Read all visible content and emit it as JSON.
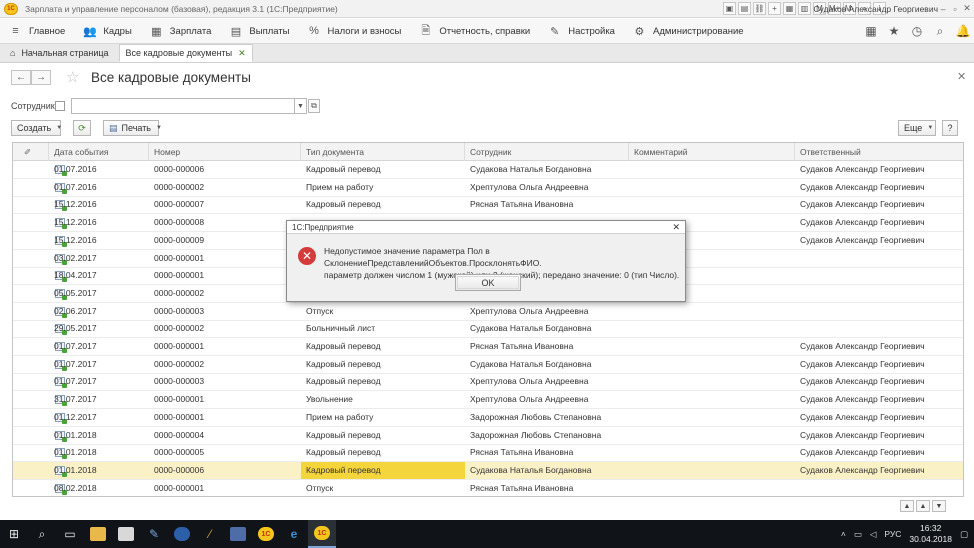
{
  "window": {
    "title": "Зарплата и управление персоналом (базовая), редакция 3.1 (1С:Предприятие)",
    "user": "Судаков Александр Георгиевич",
    "logo_text": "1С",
    "tools": [
      "M",
      "M+",
      "M-"
    ]
  },
  "main_menu": {
    "items": [
      {
        "icon": "≡",
        "label": "Главное"
      },
      {
        "icon": "👥",
        "label": "Кадры"
      },
      {
        "icon": "▦",
        "label": "Зарплата"
      },
      {
        "icon": "▤",
        "label": "Выплаты"
      },
      {
        "icon": "%",
        "label": "Налоги и взносы"
      },
      {
        "icon": "🗎",
        "label": "Отчетность, справки"
      },
      {
        "icon": "✎",
        "label": "Настройка"
      },
      {
        "icon": "⚙",
        "label": "Администрирование"
      }
    ]
  },
  "tabs": {
    "home": "Начальная страница",
    "active": "Все кадровые документы"
  },
  "form": {
    "title": "Все кадровые документы",
    "filter_label": "Сотрудник:",
    "employee_value": "",
    "create_label": "Создать",
    "print_label": "Печать",
    "more_label": "Еще",
    "help_label": "?"
  },
  "table": {
    "columns": [
      "",
      "Дата события",
      "Номер",
      "Тип документа",
      "Сотрудник",
      "Комментарий",
      "Ответственный"
    ],
    "rows": [
      {
        "date": "01.07.2016",
        "number": "0000-000006",
        "type": "Кадровый перевод",
        "employee": "Судакова Наталья Богдановна",
        "comment": "",
        "responsible": "Судаков Александр Георгиевич"
      },
      {
        "date": "01.07.2016",
        "number": "0000-000002",
        "type": "Прием на работу",
        "employee": "Хрептулова Ольга Андреевна",
        "comment": "",
        "responsible": "Судаков Александр Георгиевич"
      },
      {
        "date": "15.12.2016",
        "number": "0000-000007",
        "type": "Кадровый перевод",
        "employee": "Рясная Татьяна Ивановна",
        "comment": "",
        "responsible": "Судаков Александр Георгиевич"
      },
      {
        "date": "15.12.2016",
        "number": "0000-000008",
        "type": "",
        "employee": "",
        "comment": "",
        "responsible": "Судаков Александр Георгиевич"
      },
      {
        "date": "15.12.2016",
        "number": "0000-000009",
        "type": "",
        "employee": "",
        "comment": "",
        "responsible": "Судаков Александр Георгиевич"
      },
      {
        "date": "03.02.2017",
        "number": "0000-000001",
        "type": "",
        "employee": "",
        "comment": "",
        "responsible": ""
      },
      {
        "date": "18.04.2017",
        "number": "0000-000001",
        "type": "",
        "employee": "",
        "comment": "",
        "responsible": ""
      },
      {
        "date": "05.05.2017",
        "number": "0000-000002",
        "type": "",
        "employee": "",
        "comment": "",
        "responsible": ""
      },
      {
        "date": "02.06.2017",
        "number": "0000-000003",
        "type": "Отпуск",
        "employee": "Хрептулова Ольга Андреевна",
        "comment": "",
        "responsible": ""
      },
      {
        "date": "29.05.2017",
        "number": "0000-000002",
        "type": "Больничный лист",
        "employee": "Судакова Наталья Богдановна",
        "comment": "",
        "responsible": ""
      },
      {
        "date": "01.07.2017",
        "number": "0000-000001",
        "type": "Кадровый перевод",
        "employee": "Рясная Татьяна Ивановна",
        "comment": "",
        "responsible": "Судаков Александр Георгиевич"
      },
      {
        "date": "01.07.2017",
        "number": "0000-000002",
        "type": "Кадровый перевод",
        "employee": "Судакова Наталья Богдановна",
        "comment": "",
        "responsible": "Судаков Александр Георгиевич"
      },
      {
        "date": "01.07.2017",
        "number": "0000-000003",
        "type": "Кадровый перевод",
        "employee": "Хрептулова Ольга Андреевна",
        "comment": "",
        "responsible": "Судаков Александр Георгиевич"
      },
      {
        "date": "31.07.2017",
        "number": "0000-000001",
        "type": "Увольнение",
        "employee": "Хрептулова Ольга Андреевна",
        "comment": "",
        "responsible": "Судаков Александр Георгиевич"
      },
      {
        "date": "01.12.2017",
        "number": "0000-000001",
        "type": "Прием на работу",
        "employee": "Задорожная Любовь Степановна",
        "comment": "",
        "responsible": "Судаков Александр Георгиевич"
      },
      {
        "date": "01.01.2018",
        "number": "0000-000004",
        "type": "Кадровый перевод",
        "employee": "Задорожная Любовь Степановна",
        "comment": "",
        "responsible": "Судаков Александр Георгиевич"
      },
      {
        "date": "01.01.2018",
        "number": "0000-000005",
        "type": "Кадровый перевод",
        "employee": "Рясная Татьяна Ивановна",
        "comment": "",
        "responsible": "Судаков Александр Георгиевич"
      },
      {
        "date": "01.01.2018",
        "number": "0000-000006",
        "type": "Кадровый перевод",
        "employee": "Судакова Наталья Богдановна",
        "comment": "",
        "responsible": "Судаков Александр Георгиевич",
        "selected": true
      },
      {
        "date": "08.02.2018",
        "number": "0000-000001",
        "type": "Отпуск",
        "employee": "Рясная Татьяна Ивановна",
        "comment": "",
        "responsible": ""
      }
    ]
  },
  "dialog": {
    "title": "1С:Предприятие",
    "message_line1": "Недопустимое значение параметра Пол в СклонениеПредставленийОбъектов.ПросклонятьФИО.",
    "message_line2": "параметр должен числом 1 (мужской) или 2 (женский); передано значение: 0 (тип Число).",
    "ok_label": "OK"
  },
  "taskbar": {
    "language": "РУС",
    "time": "16:32",
    "date": "30.04.2018"
  },
  "colors": {
    "selected_row": "#fbf1c7",
    "selected_cell": "#f5d53c",
    "error_icon": "#d63b3b"
  }
}
